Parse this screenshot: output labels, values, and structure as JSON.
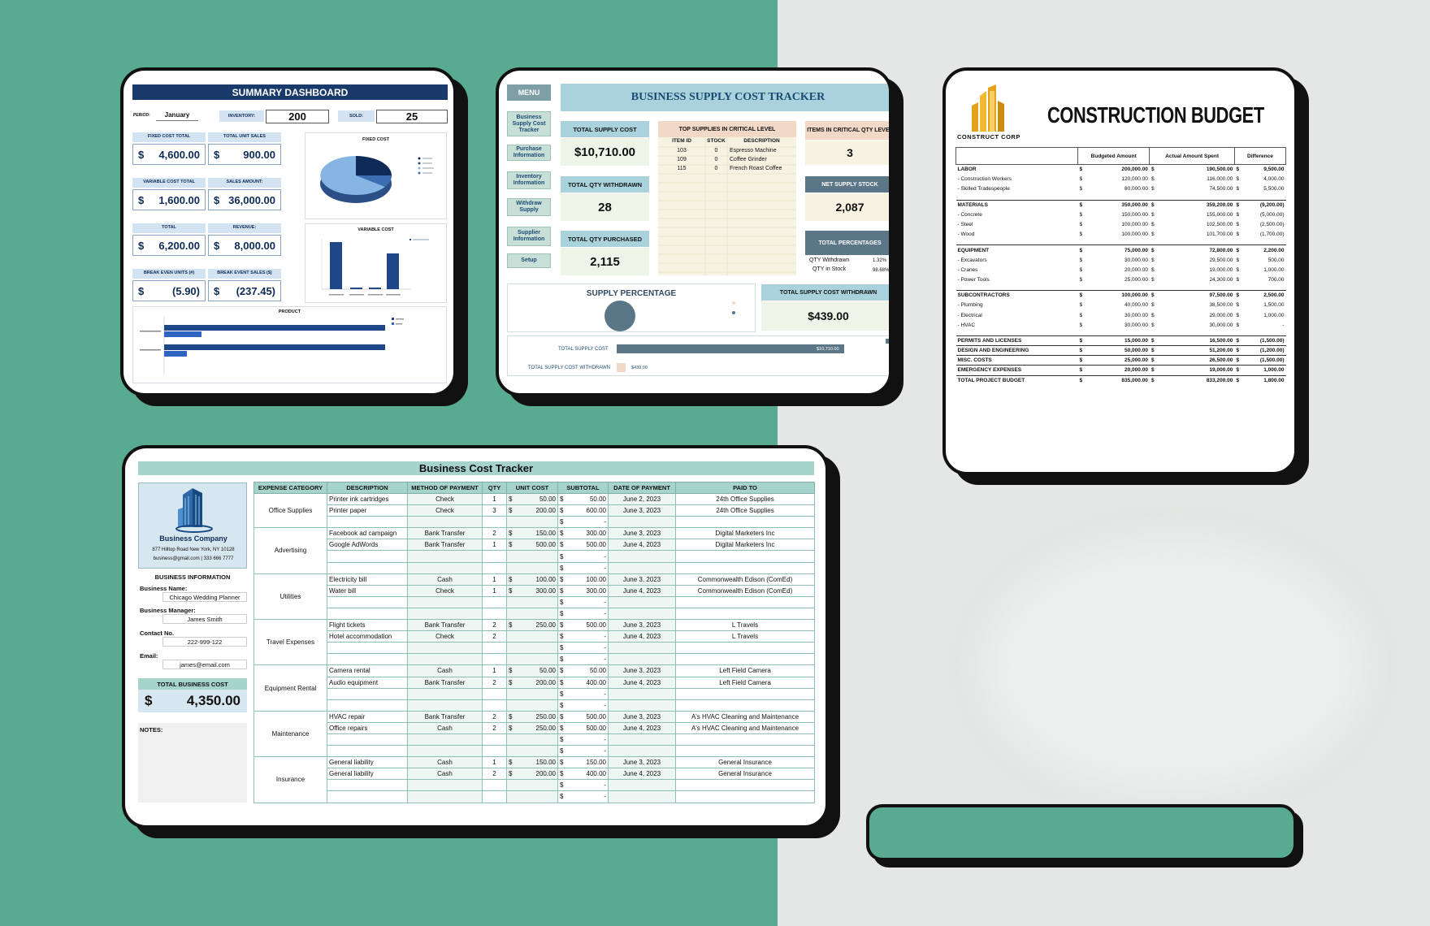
{
  "summary": {
    "title": "SUMMARY DASHBOARD",
    "period_label": "PERIOD:",
    "period_value": "January",
    "inventory_label": "INVENTORY:",
    "inventory_value": "200",
    "sold_label": "SOLD:",
    "sold_value": "25",
    "kpis": [
      {
        "label": "FIXED COST TOTAL",
        "currency": "$",
        "value": "4,600.00"
      },
      {
        "label": "TOTAL UNIT SALES",
        "currency": "$",
        "value": "900.00"
      },
      {
        "label": "VARIABLE COST TOTAL",
        "currency": "$",
        "value": "1,600.00"
      },
      {
        "label": "SALES AMOUNT:",
        "currency": "$",
        "value": "36,000.00"
      },
      {
        "label": "TOTAL",
        "currency": "$",
        "value": "6,200.00"
      },
      {
        "label": "REVENUE:",
        "currency": "$",
        "value": "8,000.00"
      },
      {
        "label": "BREAK EVEN UNITS (#)",
        "currency": "$",
        "value": "(5.90)"
      },
      {
        "label": "BREAK EVENT SALES ($)",
        "currency": "$",
        "value": "(237.45)"
      }
    ],
    "fixed_cost_title": "FIXED COST",
    "variable_cost_title": "VARIABLE COST",
    "product_title": "PRODUCT"
  },
  "supply": {
    "menu_label": "MENU",
    "title": "BUSINESS SUPPLY COST TRACKER",
    "menu_items": [
      "Business Supply Cost Tracker",
      "Purchase Information",
      "Inventory Information",
      "Withdraw Supply",
      "Supplier Information",
      "Setup"
    ],
    "total_supply_cost_label": "TOTAL SUPPLY COST",
    "total_supply_cost_value": "$10,710.00",
    "total_qty_withdrawn_label": "TOTAL QTY WITHDRAWN",
    "total_qty_withdrawn_value": "28",
    "total_qty_purchased_label": "TOTAL QTY PURCHASED",
    "total_qty_purchased_value": "2,115",
    "critical_title": "TOP SUPPLIES IN CRITICAL LEVEL",
    "critical_headers": [
      "ITEM ID",
      "STOCK",
      "DESCRIPTION"
    ],
    "critical_rows": [
      [
        "103",
        "0",
        "Espresso Machine"
      ],
      [
        "109",
        "0",
        "Coffee Grinder"
      ],
      [
        "115",
        "0",
        "French Roast Coffee"
      ]
    ],
    "items_critical_label": "ITEMS IN CRITICAL QTY LEVEL",
    "items_critical_value": "3",
    "net_supply_label": "NET SUPPLY STOCK",
    "net_supply_value": "2,087",
    "total_percentages_label": "TOTAL PERCENTAGES",
    "qty_withdrawn_label": "QTY Withdrawn",
    "qty_withdrawn_pct": "1.32%",
    "qty_stock_label": "QTY in Stock",
    "qty_stock_pct": "98.68%",
    "supply_percentage_title": "SUPPLY PERCENTAGE",
    "tscw_label": "TOTAL SUPPLY COST WITHDRAWN",
    "tscw_value": "$439.00",
    "bar_labels": [
      "TOTAL SUPPLY COST",
      "TOTAL SUPPLY COST WITHDRAWN"
    ],
    "bar_values": [
      "$10,710.00",
      "$439.00"
    ]
  },
  "construction": {
    "logo_text": "CONSTRUCT CORP",
    "title": "CONSTRUCTION BUDGET",
    "headers": [
      "Budgeted Amount",
      "Actual Amount Spent",
      "Difference"
    ],
    "sections": [
      {
        "name": "LABOR",
        "b": "200,000.00",
        "a": "190,500.00",
        "d": "9,500.00",
        "items": [
          {
            "name": "- Construction Workers",
            "b": "120,000.00",
            "a": "116,000.00",
            "d": "4,000.00"
          },
          {
            "name": "- Skilled Tradespeople",
            "b": "80,000.00",
            "a": "74,500.00",
            "d": "5,500.00"
          }
        ]
      },
      {
        "name": "MATERIALS",
        "b": "350,000.00",
        "a": "359,200.00",
        "d": "(9,200.00)",
        "items": [
          {
            "name": "- Concrete",
            "b": "150,000.00",
            "a": "155,000.00",
            "d": "(5,000.00)"
          },
          {
            "name": "- Steel",
            "b": "100,000.00",
            "a": "102,500.00",
            "d": "(2,500.00)"
          },
          {
            "name": "- Wood",
            "b": "100,000.00",
            "a": "101,700.00",
            "d": "(1,700.00)"
          }
        ]
      },
      {
        "name": "EQUIPMENT",
        "b": "75,000.00",
        "a": "72,800.00",
        "d": "2,200.00",
        "items": [
          {
            "name": "- Excavators",
            "b": "30,000.00",
            "a": "29,500.00",
            "d": "500.00"
          },
          {
            "name": "- Cranes",
            "b": "20,000.00",
            "a": "19,000.00",
            "d": "1,000.00"
          },
          {
            "name": "- Power Tools",
            "b": "25,000.00",
            "a": "24,300.00",
            "d": "700.00"
          }
        ]
      },
      {
        "name": "SUBCONTRACTORS",
        "b": "100,000.00",
        "a": "97,500.00",
        "d": "2,500.00",
        "items": [
          {
            "name": "- Plumbing",
            "b": "40,000.00",
            "a": "38,500.00",
            "d": "1,500.00"
          },
          {
            "name": "- Electrical",
            "b": "30,000.00",
            "a": "29,000.00",
            "d": "1,000.00"
          },
          {
            "name": "- HVAC",
            "b": "30,000.00",
            "a": "30,000.00",
            "d": "-"
          }
        ]
      },
      {
        "name": "PERMITS AND LICENSES",
        "b": "15,000.00",
        "a": "16,500.00",
        "d": "(1,500.00)",
        "items": []
      },
      {
        "name": "DESIGN AND ENGINEERING",
        "b": "50,000.00",
        "a": "51,200.00",
        "d": "(1,200.00)",
        "items": []
      },
      {
        "name": "MISC. COSTS",
        "b": "25,000.00",
        "a": "26,500.00",
        "d": "(1,500.00)",
        "items": []
      },
      {
        "name": "EMERGENCY EXPENSES",
        "b": "20,000.00",
        "a": "19,000.00",
        "d": "1,000.00",
        "items": []
      },
      {
        "name": "TOTAL PROJECT BUDGET",
        "b": "835,000.00",
        "a": "833,200.00",
        "d": "1,800.00",
        "items": []
      }
    ]
  },
  "tracker": {
    "title": "Business Cost Tracker",
    "company_name": "Business Company",
    "address": "877 Hilltop Road New York, NY 10128",
    "contact": "business@gmail.com | 333 666 7777",
    "info_title": "BUSINESS INFORMATION",
    "name_label": "Business Name:",
    "name_value": "Chicago Wedding Planner",
    "manager_label": "Business Manager:",
    "manager_value": "James Smith",
    "contact_label": "Contact No.",
    "contact_value": "222-999-122",
    "email_label": "Email:",
    "email_value": "james@email.com",
    "total_label": "TOTAL BUSINESS COST",
    "total_currency": "$",
    "total_value": "4,350.00",
    "notes_label": "NOTES:",
    "headers": [
      "EXPENSE CATEGORY",
      "DESCRIPTION",
      "METHOD OF PAYMENT",
      "QTY",
      "UNIT COST",
      "SUBTOTAL",
      "DATE OF PAYMENT",
      "PAID TO"
    ],
    "groups": [
      {
        "category": "Office Supplies",
        "rows": [
          {
            "desc": "Printer ink cartridges",
            "method": "Check",
            "qty": "1",
            "unit": "50.00",
            "sub": "50.00",
            "date": "June 2, 2023",
            "paid": "24th Office Supplies"
          },
          {
            "desc": "Printer paper",
            "method": "Check",
            "qty": "3",
            "unit": "200.00",
            "sub": "600.00",
            "date": "June 3, 2023",
            "paid": "24th Office Supplies"
          },
          {
            "desc": "",
            "method": "",
            "qty": "",
            "unit": "",
            "sub": "-",
            "date": "",
            "paid": ""
          }
        ]
      },
      {
        "category": "Advertising",
        "rows": [
          {
            "desc": "Facebook ad campaign",
            "method": "Bank Transfer",
            "qty": "2",
            "unit": "150.00",
            "sub": "300.00",
            "date": "June 3, 2023",
            "paid": "Digital Marketers Inc"
          },
          {
            "desc": "Google AdWords",
            "method": "Bank Transfer",
            "qty": "1",
            "unit": "500.00",
            "sub": "500.00",
            "date": "June 4, 2023",
            "paid": "Digital Marketers Inc"
          },
          {
            "desc": "",
            "method": "",
            "qty": "",
            "unit": "",
            "sub": "-",
            "date": "",
            "paid": ""
          },
          {
            "desc": "",
            "method": "",
            "qty": "",
            "unit": "",
            "sub": "-",
            "date": "",
            "paid": ""
          }
        ]
      },
      {
        "category": "Utilities",
        "rows": [
          {
            "desc": "Electricity bill",
            "method": "Cash",
            "qty": "1",
            "unit": "100.00",
            "sub": "100.00",
            "date": "June 3, 2023",
            "paid": "Commonwealth Edison (ComEd)"
          },
          {
            "desc": "Water bill",
            "method": "Check",
            "qty": "1",
            "unit": "300.00",
            "sub": "300.00",
            "date": "June 4, 2023",
            "paid": "Commonwealth Edison (ComEd)"
          },
          {
            "desc": "",
            "method": "",
            "qty": "",
            "unit": "",
            "sub": "-",
            "date": "",
            "paid": ""
          },
          {
            "desc": "",
            "method": "",
            "qty": "",
            "unit": "",
            "sub": "-",
            "date": "",
            "paid": ""
          }
        ]
      },
      {
        "category": "Travel Expenses",
        "rows": [
          {
            "desc": "Flight tickets",
            "method": "Bank Transfer",
            "qty": "2",
            "unit": "250.00",
            "sub": "500.00",
            "date": "June 3, 2023",
            "paid": "L Travels"
          },
          {
            "desc": "Hotel accommodation",
            "method": "Check",
            "qty": "2",
            "unit": "",
            "sub": "-",
            "date": "June 4, 2023",
            "paid": "L Travels"
          },
          {
            "desc": "",
            "method": "",
            "qty": "",
            "unit": "",
            "sub": "-",
            "date": "",
            "paid": ""
          },
          {
            "desc": "",
            "method": "",
            "qty": "",
            "unit": "",
            "sub": "-",
            "date": "",
            "paid": ""
          }
        ]
      },
      {
        "category": "Equipment Rental",
        "rows": [
          {
            "desc": "Camera rental",
            "method": "Cash",
            "qty": "1",
            "unit": "50.00",
            "sub": "50.00",
            "date": "June 3, 2023",
            "paid": "Left Field Camera"
          },
          {
            "desc": "Audio equipment",
            "method": "Bank Transfer",
            "qty": "2",
            "unit": "200.00",
            "sub": "400.00",
            "date": "June 4, 2023",
            "paid": "Left Field Camera"
          },
          {
            "desc": "",
            "method": "",
            "qty": "",
            "unit": "",
            "sub": "-",
            "date": "",
            "paid": ""
          },
          {
            "desc": "",
            "method": "",
            "qty": "",
            "unit": "",
            "sub": "-",
            "date": "",
            "paid": ""
          }
        ]
      },
      {
        "category": "Maintenance",
        "rows": [
          {
            "desc": "HVAC repair",
            "method": "Bank Transfer",
            "qty": "2",
            "unit": "250.00",
            "sub": "500.00",
            "date": "June 3, 2023",
            "paid": "A's HVAC Cleaning and Maintenance"
          },
          {
            "desc": "Office repairs",
            "method": "Cash",
            "qty": "2",
            "unit": "250.00",
            "sub": "500.00",
            "date": "June 4, 2023",
            "paid": "A's HVAC Cleaning and Maintenance"
          },
          {
            "desc": "",
            "method": "",
            "qty": "",
            "unit": "",
            "sub": "-",
            "date": "",
            "paid": ""
          },
          {
            "desc": "",
            "method": "",
            "qty": "",
            "unit": "",
            "sub": "-",
            "date": "",
            "paid": ""
          }
        ]
      },
      {
        "category": "Insurance",
        "rows": [
          {
            "desc": "General liability",
            "method": "Cash",
            "qty": "1",
            "unit": "150.00",
            "sub": "150.00",
            "date": "June 3, 2023",
            "paid": "General Insurance"
          },
          {
            "desc": "General liability",
            "method": "Cash",
            "qty": "2",
            "unit": "200.00",
            "sub": "400.00",
            "date": "June 4, 2023",
            "paid": "General Insurance"
          },
          {
            "desc": "",
            "method": "",
            "qty": "",
            "unit": "",
            "sub": "-",
            "date": "",
            "paid": ""
          },
          {
            "desc": "",
            "method": "",
            "qty": "",
            "unit": "",
            "sub": "-",
            "date": "",
            "paid": ""
          }
        ]
      }
    ]
  },
  "colors": {
    "bg_green": "#58aa91",
    "bg_grey": "#e4e7e5",
    "navy": "#1a3a6b",
    "teal": "#a6d4cb",
    "gold": "#e3a21a"
  }
}
